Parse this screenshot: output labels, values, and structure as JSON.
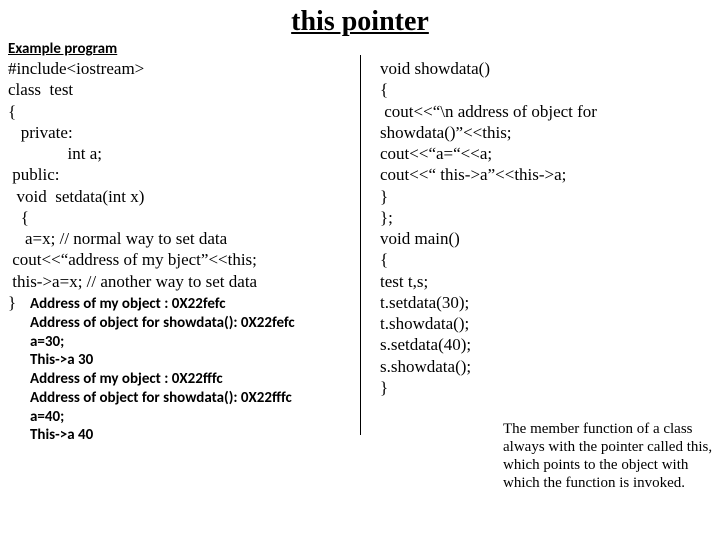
{
  "title": "this pointer",
  "subheading": "Example program",
  "left_code": "#include<iostream>\nclass  test\n{\n   private:\n              int a;\n public:\n  void  setdata(int x)\n   {\n    a=x; // normal way to set data\n cout<<“address of my bject”<<this;\n this->a=x; // another way to set data\n}",
  "output": "Address of my object : 0X22fefc\nAddress of object for showdata(): 0X22fefc\na=30;\nThis->a 30\nAddress of my object : 0X22fffc\nAddress of object for showdata(): 0X22fffc\na=40;\nThis->a 40",
  "right_code": "void showdata()\n{\n cout<<“\\n address of object for\nshowdata()”<<this;\ncout<<“a=“<<a;\ncout<<“ this->a”<<this->a;\n}\n};\nvoid main()\n{\ntest t,s;\nt.setdata(30);\nt.showdata();\ns.setdata(40);\ns.showdata();\n}",
  "note": "The member function of a class always with the pointer called this, which points to the  object with which the function is invoked."
}
